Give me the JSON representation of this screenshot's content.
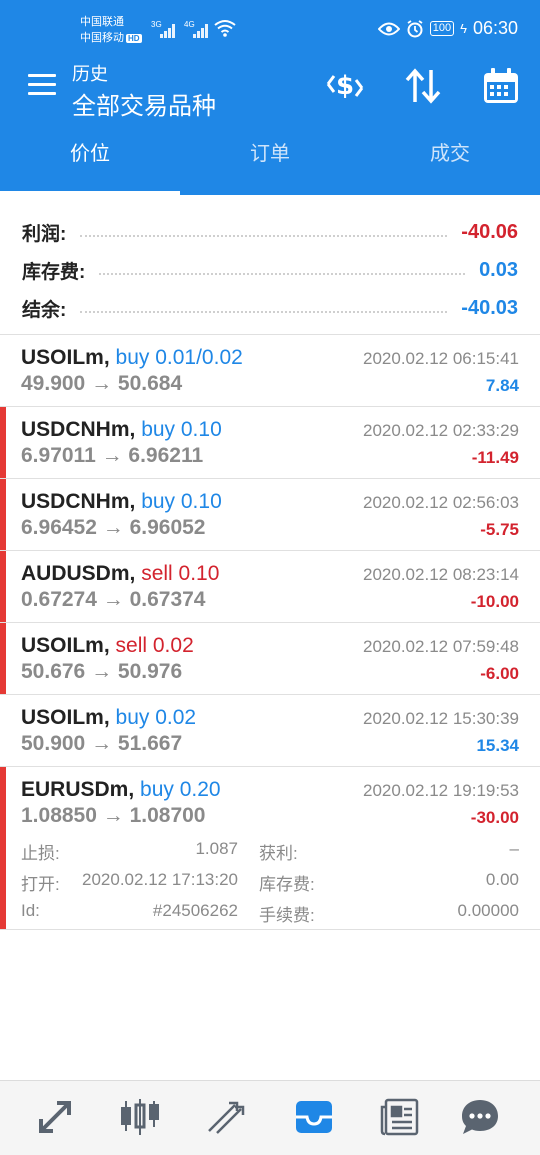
{
  "status_bar": {
    "carrier1": "中国联通",
    "carrier2": "中国移动",
    "hd": "HD",
    "net1": "3G",
    "net2": "4G",
    "battery": "100",
    "time": "06:30"
  },
  "app_bar": {
    "subtitle": "历史",
    "title": "全部交易品种"
  },
  "tabs": [
    {
      "label": "价位",
      "active": true
    },
    {
      "label": "订单",
      "active": false
    },
    {
      "label": "成交",
      "active": false
    }
  ],
  "summary": {
    "profit_label": "利润:",
    "profit_value": "-40.06",
    "swap_label": "库存费:",
    "swap_value": "0.03",
    "balance_label": "结余:",
    "balance_value": "-40.03"
  },
  "trades": [
    {
      "symbol": "USOILm,",
      "action": "buy 0.01/0.02",
      "side": "buy",
      "prices": "49.900 → 50.684",
      "time": "2020.02.12 06:15:41",
      "profit": "7.84",
      "positive": true,
      "loss_bar": false
    },
    {
      "symbol": "USDCNHm,",
      "action": "buy 0.10",
      "side": "buy",
      "prices": "6.97011 → 6.96211",
      "time": "2020.02.12 02:33:29",
      "profit": "-11.49",
      "positive": false,
      "loss_bar": true
    },
    {
      "symbol": "USDCNHm,",
      "action": "buy 0.10",
      "side": "buy",
      "prices": "6.96452 → 6.96052",
      "time": "2020.02.12 02:56:03",
      "profit": "-5.75",
      "positive": false,
      "loss_bar": true
    },
    {
      "symbol": "AUDUSDm,",
      "action": "sell 0.10",
      "side": "sell",
      "prices": "0.67274 → 0.67374",
      "time": "2020.02.12 08:23:14",
      "profit": "-10.00",
      "positive": false,
      "loss_bar": true
    },
    {
      "symbol": "USOILm,",
      "action": "sell 0.02",
      "side": "sell",
      "prices": "50.676 → 50.976",
      "time": "2020.02.12 07:59:48",
      "profit": "-6.00",
      "positive": false,
      "loss_bar": true
    },
    {
      "symbol": "USOILm,",
      "action": "buy 0.02",
      "side": "buy",
      "prices": "50.900 → 51.667",
      "time": "2020.02.12 15:30:39",
      "profit": "15.34",
      "positive": true,
      "loss_bar": false
    }
  ],
  "expanded_trade": {
    "symbol": "EURUSDm,",
    "action": "buy 0.20",
    "prices": "1.08850 → 1.08700",
    "time": "2020.02.12 19:19:53",
    "profit": "-30.00",
    "sl_label": "止损:",
    "sl_value": "1.087",
    "tp_label": "获利:",
    "tp_value": "–",
    "open_label": "打开:",
    "open_value": "2020.02.12 17:13:20",
    "swap_label": "库存费:",
    "swap_value": "0.00",
    "id_label": "Id:",
    "id_value": "#24506262",
    "fee_label": "手续费:",
    "fee_value": "0.00000"
  },
  "colors": {
    "primary": "#1f87e6",
    "negative": "#d3232e",
    "loss_bar": "#e53935",
    "muted": "#8a8a8a"
  },
  "bottom_nav": [
    {
      "icon": "quotes-icon",
      "active": false
    },
    {
      "icon": "candlestick-chart-icon",
      "active": false
    },
    {
      "icon": "trade-icon",
      "active": false
    },
    {
      "icon": "history-inbox-icon",
      "active": true
    },
    {
      "icon": "news-icon",
      "active": false
    },
    {
      "icon": "chat-icon",
      "active": false
    }
  ]
}
